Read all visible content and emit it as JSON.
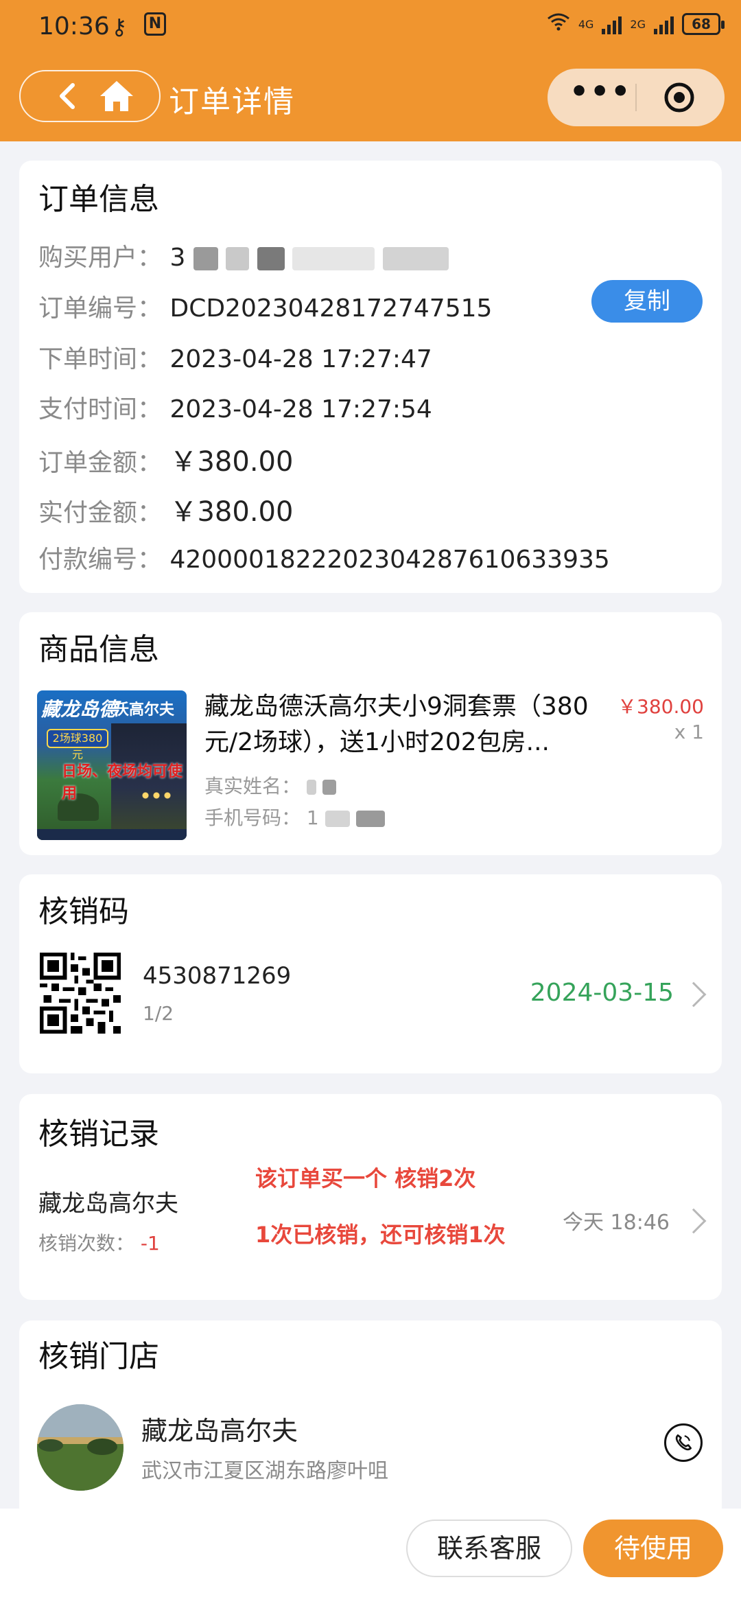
{
  "status_bar": {
    "time": "10:36",
    "net1": "4G",
    "net2": "2G",
    "battery": "68"
  },
  "header": {
    "title": "订单详情",
    "more": "•••"
  },
  "order_info": {
    "title": "订单信息",
    "buyer_label": "购买用户：",
    "buyer_value": "3",
    "order_no_label": "订单编号：",
    "order_no": "DCD20230428172747515",
    "copy_label": "复制",
    "order_time_label": "下单时间：",
    "order_time": "2023-04-28 17:27:47",
    "pay_time_label": "支付时间：",
    "pay_time": "2023-04-28 17:27:54",
    "amount_label": "订单金额：",
    "amount": "￥380.00",
    "paid_label": "实付金额：",
    "paid": "￥380.00",
    "pay_no_label": "付款编号：",
    "pay_no": "4200001822202304287610633935"
  },
  "product_info": {
    "title": "商品信息",
    "thumb_text1": "藏龙岛德",
    "thumb_text2": "沃高尔夫",
    "thumb_text3": "2场球380元",
    "thumb_text4": "日场、夜场均可使用",
    "name": "藏龙岛德沃高尔夫小9洞套票（380元/2场球），送1小时202包房...",
    "price": "￥380.00",
    "qty": "x 1",
    "real_name_label": "真实姓名：",
    "phone_label": "手机号码：",
    "phone_value": "1"
  },
  "verify_code": {
    "title": "核销码",
    "code": "4530871269",
    "count": "1/2",
    "date": "2024-03-15"
  },
  "verify_record": {
    "title": "核销记录",
    "store": "藏龙岛高尔夫",
    "count_label": "核销次数：",
    "count_value": "-1",
    "time": "今天 18:46",
    "note1": "该订单买一个 核销2次",
    "note2": "1次已核销，还可核销1次"
  },
  "verify_store": {
    "title": "核销门店",
    "name": "藏龙岛高尔夫",
    "address": "武汉市江夏区湖东路廖叶咀"
  },
  "bottom": {
    "service": "联系客服",
    "status": "待使用"
  },
  "colors": {
    "brand": "#f0952f",
    "copy": "#3a8de8",
    "price": "#e0413e",
    "date": "#35a35a",
    "note": "#e8483c"
  }
}
